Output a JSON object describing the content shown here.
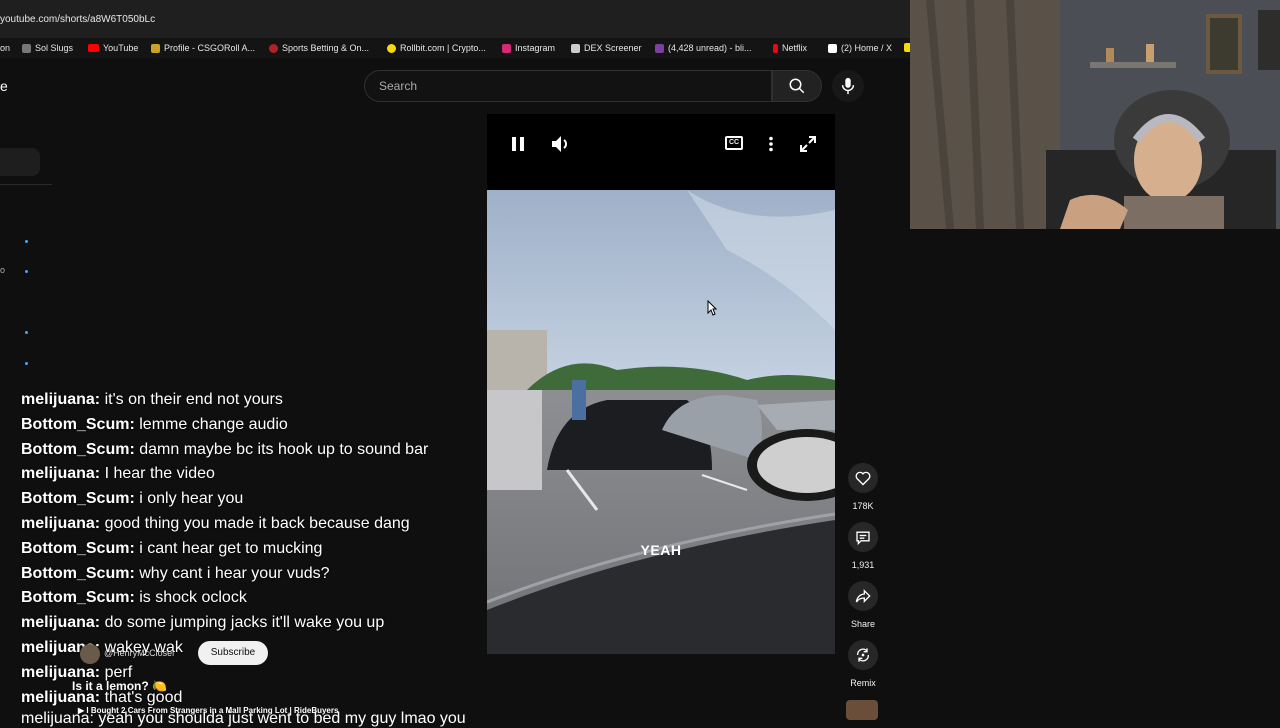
{
  "browser": {
    "url": "youtube.com/shorts/a8W6T050bLc",
    "bookmarks": [
      {
        "label": "on",
        "icon": "bookmark-icon",
        "color": "#555555"
      },
      {
        "label": "Sol Slugs",
        "icon": "sol-slugs-icon",
        "color": "#888888"
      },
      {
        "label": "YouTube",
        "icon": "youtube-icon",
        "color": "#ff0000"
      },
      {
        "label": "Profile - CSGORoll A...",
        "icon": "csgoroll-icon",
        "color": "#c9a227"
      },
      {
        "label": "Sports Betting & On...",
        "icon": "sports-betting-icon",
        "color": "#b22222"
      },
      {
        "label": "Rollbit.com | Crypto...",
        "icon": "rollbit-icon",
        "color": "#f5d90a"
      },
      {
        "label": "Instagram",
        "icon": "instagram-icon",
        "color": "#d62976"
      },
      {
        "label": "DEX Screener",
        "icon": "dex-screener-icon",
        "color": "#cccccc"
      },
      {
        "label": "(4,428 unread) - bli...",
        "icon": "mail-icon",
        "color": "#7b3fa0"
      },
      {
        "label": "Netflix",
        "icon": "netflix-icon",
        "color": "#e50914"
      },
      {
        "label": "(2) Home / X",
        "icon": "x-icon",
        "color": "#ffffff"
      }
    ]
  },
  "header": {
    "search_placeholder": "Search",
    "search_icon": "search-icon",
    "mic_icon": "microphone-icon",
    "left_label": "e"
  },
  "video": {
    "caption": "YEAH",
    "controls": [
      "pause-icon",
      "volume-icon",
      "closed-captions-icon",
      "more-vert-icon",
      "fullscreen-icon"
    ],
    "cc_label": "CC"
  },
  "actions": {
    "like_count": "178K",
    "comment_count": "1,931",
    "share_label": "Share",
    "remix_label": "Remix"
  },
  "chat": [
    {
      "user": "melijuana:",
      "message": "it's on their end not yours"
    },
    {
      "user": "Bottom_Scum:",
      "message": "lemme change audio"
    },
    {
      "user": "Bottom_Scum:",
      "message": "damn maybe bc its hook up to sound bar"
    },
    {
      "user": "melijuana:",
      "message": "I hear the video"
    },
    {
      "user": "Bottom_Scum:",
      "message": "i only hear you"
    },
    {
      "user": "melijuana:",
      "message": "good thing you made it back because dang"
    },
    {
      "user": "Bottom_Scum:",
      "message": "i cant hear get to mucking"
    },
    {
      "user": "Bottom_Scum:",
      "message": "why cant i hear your vuds?"
    },
    {
      "user": "Bottom_Scum:",
      "message": "is shock oclock"
    },
    {
      "user": "melijuana:",
      "message": "do some jumping jacks it'll wake you up"
    },
    {
      "user": "melijuana:",
      "message": "wakey wak"
    },
    {
      "user": "melijuana:",
      "message": "perf"
    },
    {
      "user": "melijuana:",
      "message": "that's good"
    }
  ],
  "chat_cut_line": "melijuana: yeah you shoulda just went to bed my guy lmao you",
  "short_overlay": {
    "channel_handle": "@HenryMcClosel",
    "subscribe_label": "Subscribe",
    "title": "Is it a lemon? 🍋",
    "related_video": "▶ I Bought 2 Cars From Strangers in a Mall Parking Lot | RideBuyers"
  }
}
